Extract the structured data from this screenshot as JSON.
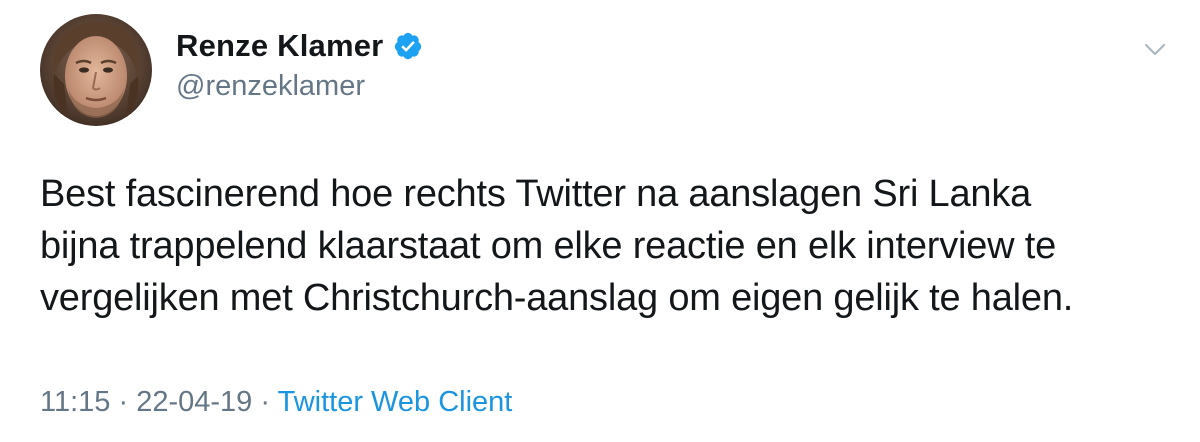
{
  "author": {
    "display_name": "Renze Klamer",
    "handle": "@renzeklamer",
    "verified": true
  },
  "tweet": {
    "lines": [
      "Best fascinerend hoe rechts Twitter na aanslagen Sri Lanka",
      "bijna trappelend klaarstaat om elke reactie en elk interview te",
      "vergelijken met Christchurch-aanslag om eigen gelijk te halen."
    ]
  },
  "meta": {
    "time": "11:15",
    "separator": "·",
    "date": "22-04-19",
    "source": "Twitter Web Client"
  },
  "icons": {
    "verified": "verified-badge-icon",
    "menu": "chevron-down-icon"
  },
  "colors": {
    "primary_text": "#14171a",
    "secondary_text": "#657786",
    "link": "#1b95e0",
    "verified_badge": "#1da1f2"
  }
}
